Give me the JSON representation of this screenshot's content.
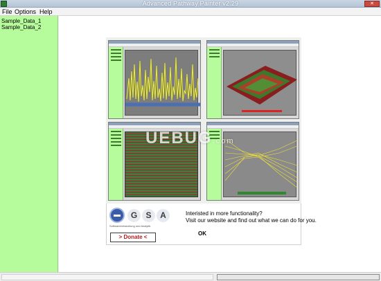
{
  "window": {
    "title": "Advanced Pathway Painter v2.29",
    "close_label": "✕"
  },
  "menu": {
    "items": [
      {
        "label": "File"
      },
      {
        "label": "Options"
      },
      {
        "label": "Help"
      }
    ]
  },
  "sidebar": {
    "items": [
      {
        "label": "Sample_Data_1"
      },
      {
        "label": "Sample_Data_2"
      }
    ]
  },
  "splash": {
    "logo_letters": [
      "G",
      "S",
      "A"
    ],
    "logo_tagline": "Softwareentwicklung und Analytik",
    "donate_label": "> Donate <",
    "promo_line1": "Interisted in more functionality?",
    "promo_line2": "Visit our website and find out what we can do for you.",
    "ok_label": "OK"
  },
  "watermark": {
    "main": "UEBUG",
    "suffix": ".com"
  },
  "colors": {
    "sidebar_bg": "#b7fc9c",
    "titlebar": "#b5c5d7",
    "donate_text": "#b31919"
  },
  "icons": {
    "app": "pathway-app-icon",
    "close": "close-icon",
    "logo": "gsa-logo-icon"
  }
}
